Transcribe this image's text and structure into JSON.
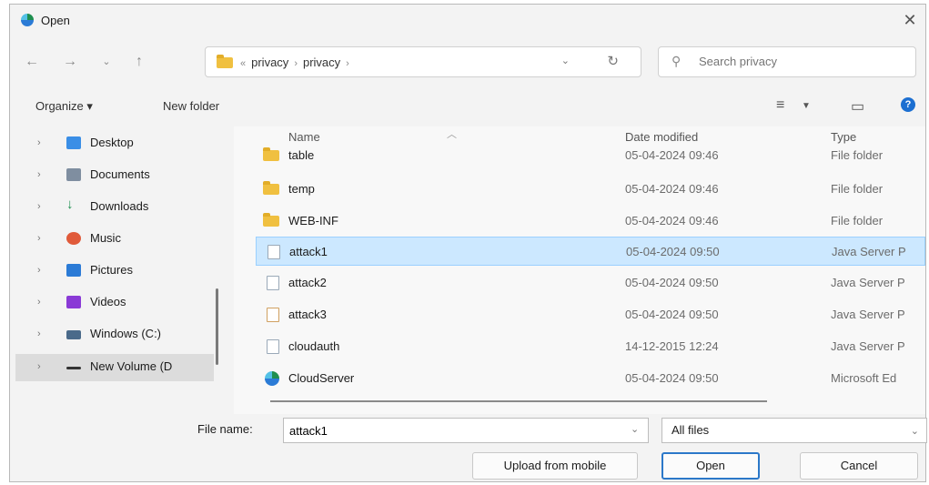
{
  "window": {
    "title": "Open"
  },
  "address": {
    "overflow": "«",
    "crumbs": [
      "privacy",
      "privacy"
    ]
  },
  "search": {
    "placeholder": "Search privacy"
  },
  "toolbar": {
    "organize": "Organize ▾",
    "new_folder": "New folder"
  },
  "sidebar": {
    "items": [
      {
        "label": "Desktop",
        "icon": "desktop-icon",
        "color": "#3a8ee6"
      },
      {
        "label": "Documents",
        "icon": "documents-icon",
        "color": "#7f8ea0"
      },
      {
        "label": "Downloads",
        "icon": "downloads-icon",
        "color": "#1e8f4f"
      },
      {
        "label": "Music",
        "icon": "music-icon",
        "color": "#e05a3a"
      },
      {
        "label": "Pictures",
        "icon": "pictures-icon",
        "color": "#2b7bd6"
      },
      {
        "label": "Videos",
        "icon": "videos-icon",
        "color": "#8a3ad6"
      },
      {
        "label": "Windows (C:)",
        "icon": "drive-icon",
        "color": "#4a6a8a"
      },
      {
        "label": "New Volume (D",
        "icon": "drive-icon",
        "color": "#333333"
      }
    ]
  },
  "columns": {
    "name": "Name",
    "date": "Date modified",
    "type": "Type"
  },
  "files": [
    {
      "name": "table",
      "date": "05-04-2024 09:46",
      "type": "File folder",
      "kind": "folder"
    },
    {
      "name": "temp",
      "date": "05-04-2024 09:46",
      "type": "File folder",
      "kind": "folder"
    },
    {
      "name": "WEB-INF",
      "date": "05-04-2024 09:46",
      "type": "File folder",
      "kind": "folder"
    },
    {
      "name": "attack1",
      "date": "05-04-2024 09:50",
      "type": "Java Server P",
      "kind": "file"
    },
    {
      "name": "attack2",
      "date": "05-04-2024 09:50",
      "type": "Java Server P",
      "kind": "file"
    },
    {
      "name": "attack3",
      "date": "05-04-2024 09:50",
      "type": "Java Server P",
      "kind": "file"
    },
    {
      "name": "cloudauth",
      "date": "14-12-2015 12:24",
      "type": "Java Server P",
      "kind": "file"
    },
    {
      "name": "CloudServer",
      "date": "05-04-2024 09:50",
      "type": "Microsoft Ed",
      "kind": "edge"
    }
  ],
  "selected_file": "attack1",
  "bottom": {
    "file_name_label": "File name:",
    "file_name_value": "attack1",
    "filter": "All files",
    "upload": "Upload from mobile",
    "open": "Open",
    "cancel": "Cancel"
  }
}
